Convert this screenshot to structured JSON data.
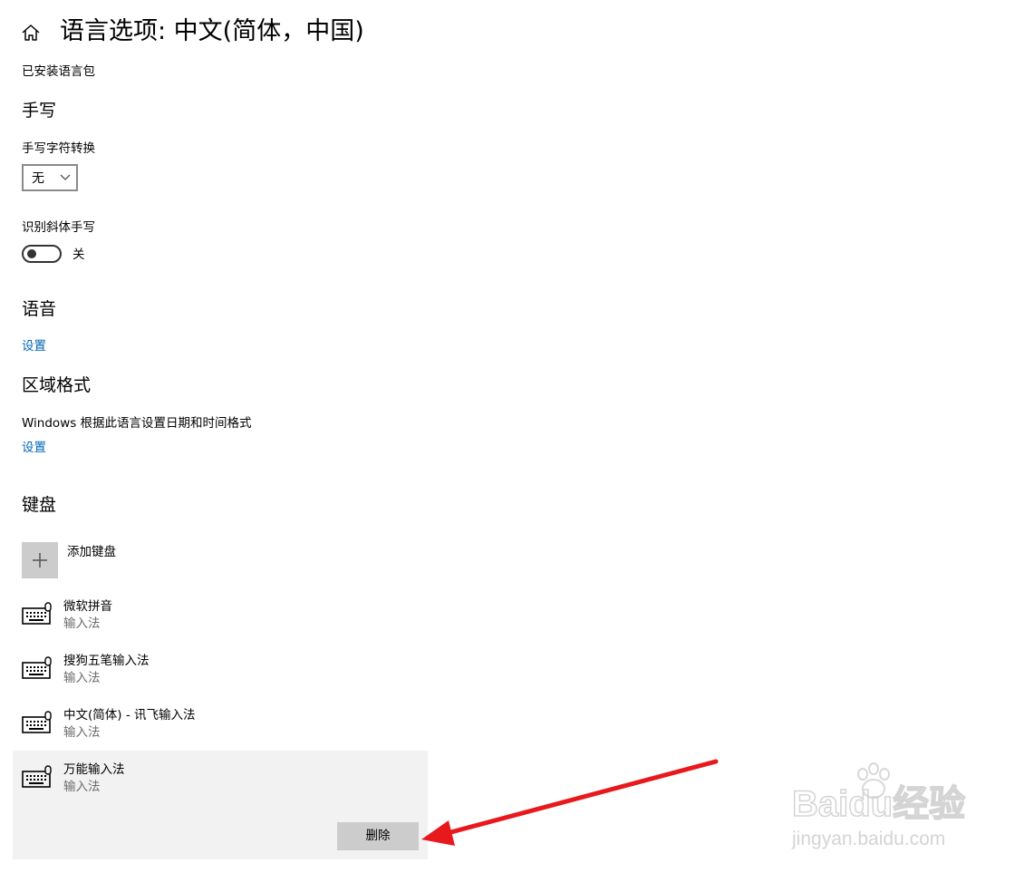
{
  "header": {
    "title": "语言选项: 中文(简体，中国)"
  },
  "installed": {
    "label": "已安装语言包"
  },
  "handwriting": {
    "heading": "手写",
    "conversion_label": "手写字符转换",
    "conversion_value": "无",
    "cursive_label": "识别斜体手写",
    "cursive_state": "关"
  },
  "speech": {
    "heading": "语音",
    "settings_link": "设置"
  },
  "region": {
    "heading": "区域格式",
    "description": "Windows 根据此语言设置日期和时间格式",
    "settings_link": "设置"
  },
  "keyboard": {
    "heading": "键盘",
    "add_label": "添加键盘",
    "items": [
      {
        "name": "微软拼音",
        "type": "输入法"
      },
      {
        "name": "搜狗五笔输入法",
        "type": "输入法"
      },
      {
        "name": "中文(简体) - 讯飞输入法",
        "type": "输入法"
      },
      {
        "name": "万能输入法",
        "type": "输入法"
      }
    ],
    "remove_label": "删除"
  },
  "watermark": {
    "brand": "Baidu经验",
    "url": "jingyan.baidu.com"
  },
  "colors": {
    "link": "#0067b8",
    "arrow": "#e8191c",
    "selected_bg": "#f2f2f2"
  }
}
